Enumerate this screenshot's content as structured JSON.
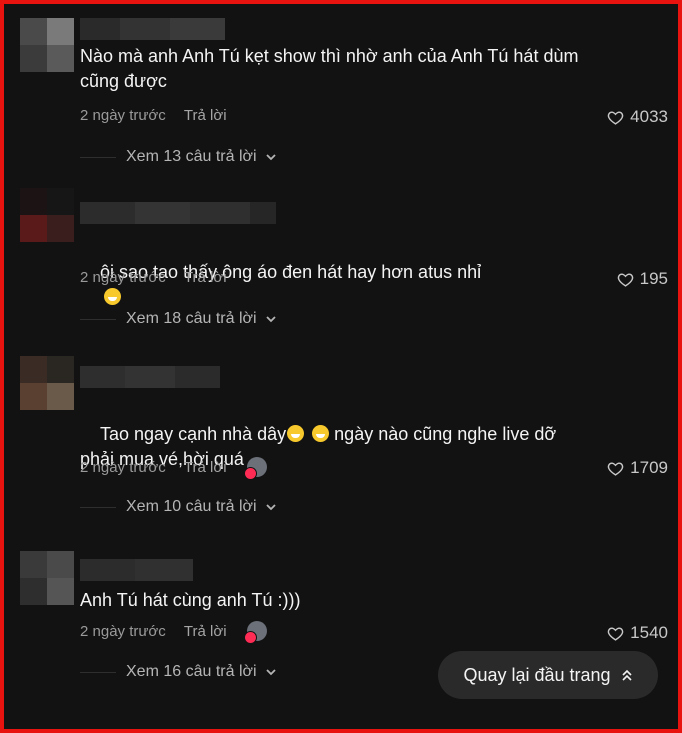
{
  "colors": {
    "background": "#121212",
    "frame": "#e8120f",
    "text": "#f4f4f4",
    "muted": "#9a9a9a",
    "like_icon": "#c8c8c8"
  },
  "comments": [
    {
      "text": "Nào mà anh Anh Tú kẹt show thì nhờ anh của Anh Tú hát dùm cũng được",
      "time": "2 ngày trước",
      "reply_label": "Trả lời",
      "likes": "4033",
      "view_replies": "Xem 13 câu trả lời",
      "creator_liked": false
    },
    {
      "text": "ôi sao tao thấy ông áo đen hát hay hơn atus nhỉ",
      "emoji": "flushed-face-emoji",
      "time": "2 ngày trước",
      "reply_label": "Trả lời",
      "likes": "195",
      "view_replies": "Xem 18 câu trả lời",
      "creator_liked": false
    },
    {
      "text_part1": "Tao ngay cạnh nhà dây",
      "text_part2": " ngày nào cũng nghe live dỡ phải mua vé,hời quá",
      "emoji": "grinning-face-emoji",
      "time": "2 ngày trước",
      "reply_label": "Trả lời",
      "likes": "1709",
      "view_replies": "Xem 10 câu trả lời",
      "creator_liked": true
    },
    {
      "text": "Anh Tú hát cùng anh Tú :)))",
      "time": "2 ngày trước",
      "reply_label": "Trả lời",
      "likes": "1540",
      "view_replies": "Xem 16 câu trả lời",
      "creator_liked": true
    }
  ],
  "back_to_top": {
    "label": "Quay lại đầu trang",
    "icon": "double-chevron-up-icon"
  }
}
